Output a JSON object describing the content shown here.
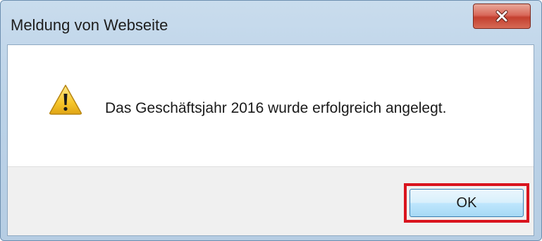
{
  "window": {
    "title": "Meldung von Webseite"
  },
  "titlebar": {
    "close_icon": "close-icon",
    "close_color": "#c4402f"
  },
  "dialog": {
    "icon": "warning-icon",
    "message": "Das Geschäftsjahr 2016 wurde erfolgreich angelegt."
  },
  "buttons": {
    "ok_label": "OK",
    "highlight_color": "#d9141e"
  }
}
